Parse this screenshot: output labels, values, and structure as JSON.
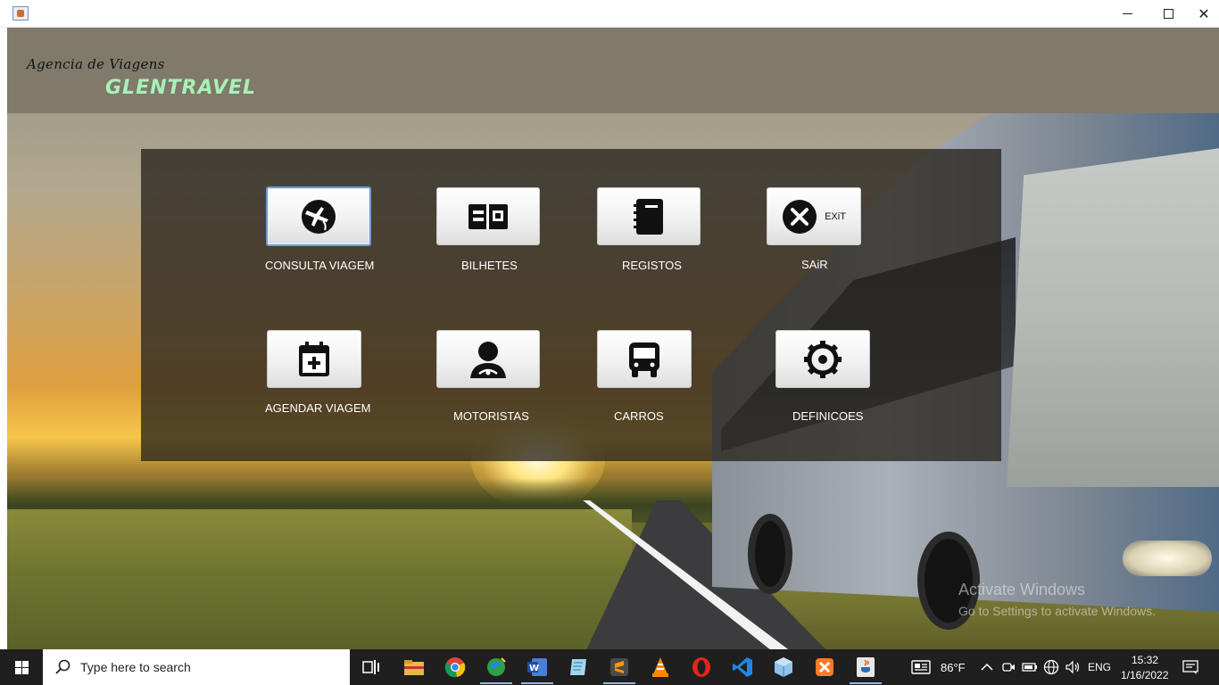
{
  "window": {
    "title": "",
    "controls": {
      "minimize": "—",
      "maximize": "☐",
      "close": "✕"
    }
  },
  "header": {
    "subtitle": "Agencia de Viagens",
    "brand": "GLENTRAVEL"
  },
  "menu": {
    "consulta_viagem": "CONSULTA VIAGEM",
    "bilhetes": "BILHETES",
    "registos": "REGISTOS",
    "sair": "SAiR",
    "exit_text": "EXiT",
    "agendar_viagem": "AGENDAR VIAGEM",
    "motoristas": "MOTORISTAS",
    "carros": "CARROS",
    "definicoes": "DEFINICOES"
  },
  "watermark": {
    "line1": "Activate Windows",
    "line2": "Go to Settings to activate Windows."
  },
  "taskbar": {
    "search_placeholder": "Type here to search",
    "weather": "86°F",
    "language": "ENG",
    "time": "15:32",
    "date": "1/16/2022",
    "pinned_icons": [
      "task-view-icon",
      "file-explorer-icon",
      "chrome-icon",
      "edge-icon",
      "word-icon",
      "notepad-icon",
      "sublime-icon",
      "vlc-icon",
      "opera-icon",
      "vscode-icon",
      "virtualbox-icon",
      "xampp-icon",
      "java-icon"
    ]
  },
  "colors": {
    "brand_green": "#a8f0b8",
    "header_band": "#7f7a6a",
    "panel": "#28241e",
    "taskbar": "#1f1f1f"
  }
}
